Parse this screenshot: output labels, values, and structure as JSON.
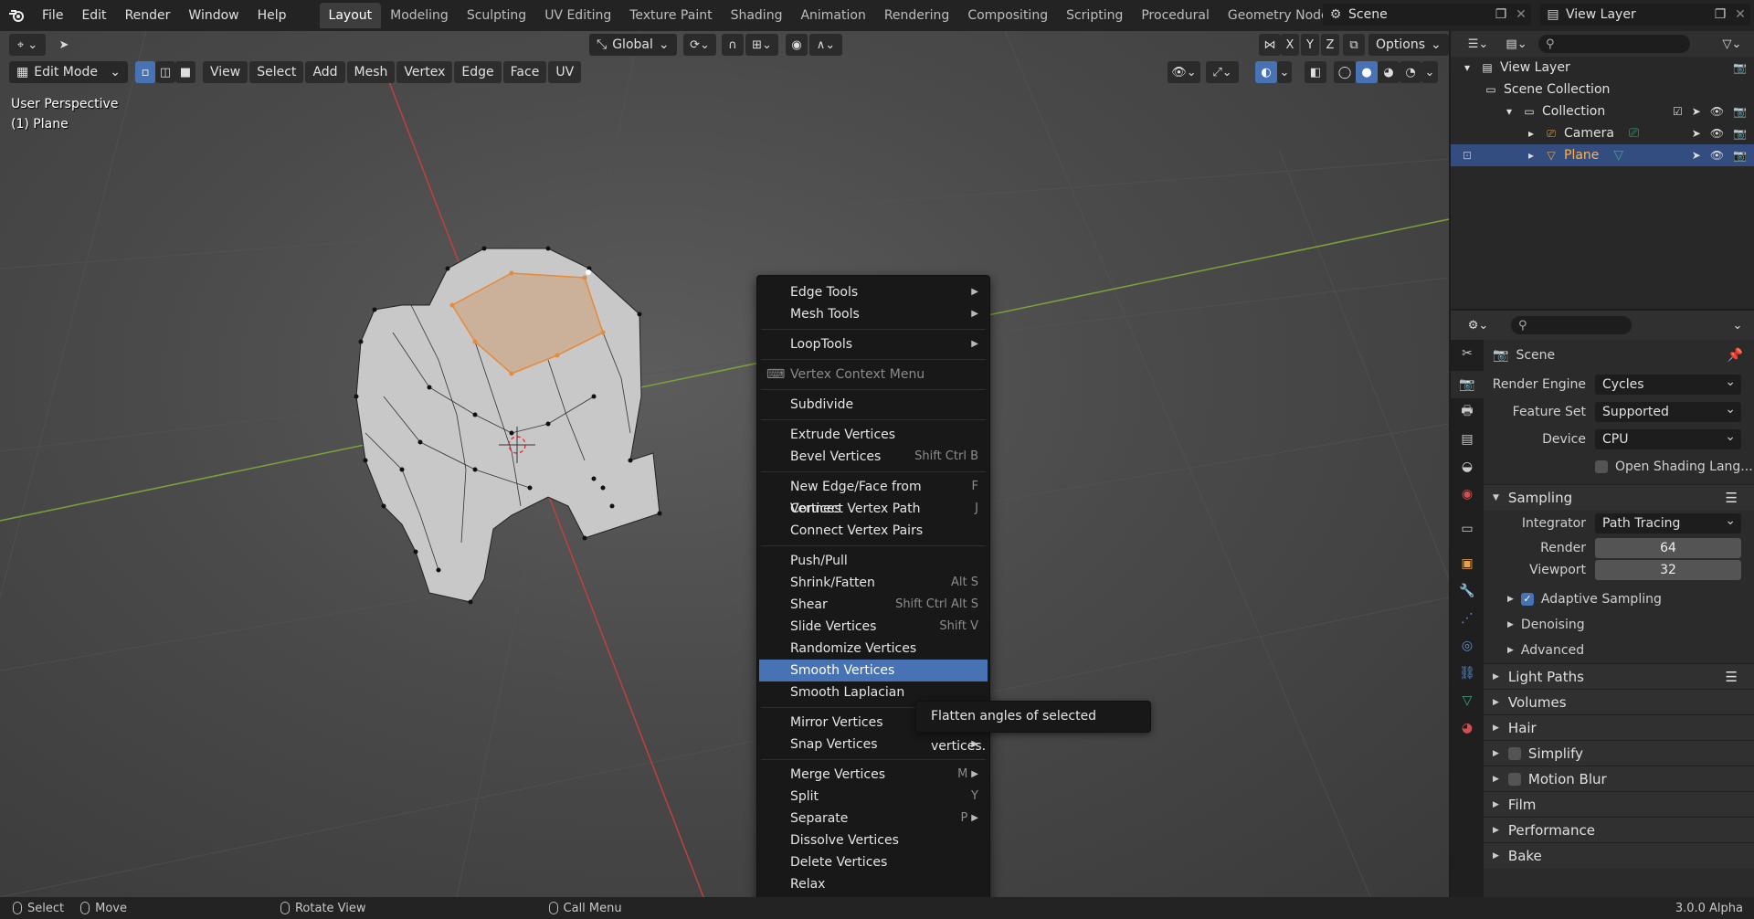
{
  "topbar": {
    "menus": [
      "File",
      "Edit",
      "Render",
      "Window",
      "Help"
    ],
    "workspaces": [
      "Layout",
      "Modeling",
      "Sculpting",
      "UV Editing",
      "Texture Paint",
      "Shading",
      "Animation",
      "Rendering",
      "Compositing",
      "Scripting",
      "Procedural",
      "Geometry Nodes"
    ],
    "active_workspace": "Layout",
    "scene": "Scene",
    "view_layer": "View Layer"
  },
  "viewport": {
    "transform_orientation": "Global",
    "options_label": "Options",
    "axes": [
      "X",
      "Y",
      "Z"
    ],
    "mode": "Edit Mode",
    "menus": [
      "View",
      "Select",
      "Add",
      "Mesh",
      "Vertex",
      "Edge",
      "Face",
      "UV"
    ],
    "perspective": "User Perspective",
    "object": "(1) Plane"
  },
  "context_menu": {
    "items": [
      {
        "label": "Edge Tools",
        "shortcut": "",
        "submenu": true
      },
      {
        "label": "Mesh Tools",
        "shortcut": "",
        "submenu": true
      },
      {
        "sep": true
      },
      {
        "label": "LoopTools",
        "shortcut": "",
        "submenu": true
      },
      {
        "sep": true
      },
      {
        "label": "Vertex Context Menu",
        "title": true
      },
      {
        "sep": true
      },
      {
        "label": "Subdivide",
        "shortcut": ""
      },
      {
        "sep": true
      },
      {
        "label": "Extrude Vertices",
        "shortcut": ""
      },
      {
        "label": "Bevel Vertices",
        "shortcut": "Shift Ctrl B"
      },
      {
        "sep": true
      },
      {
        "label": "New Edge/Face from Vertices",
        "shortcut": "F"
      },
      {
        "label": "Connect Vertex Path",
        "shortcut": "J"
      },
      {
        "label": "Connect Vertex Pairs",
        "shortcut": ""
      },
      {
        "sep": true
      },
      {
        "label": "Push/Pull",
        "shortcut": ""
      },
      {
        "label": "Shrink/Fatten",
        "shortcut": "Alt S"
      },
      {
        "label": "Shear",
        "shortcut": "Shift Ctrl Alt S"
      },
      {
        "label": "Slide Vertices",
        "shortcut": "Shift V"
      },
      {
        "label": "Randomize Vertices",
        "shortcut": ""
      },
      {
        "label": "Smooth Vertices",
        "shortcut": "",
        "highlight": true
      },
      {
        "label": "Smooth Laplacian",
        "shortcut": ""
      },
      {
        "sep": true
      },
      {
        "label": "Mirror Vertices",
        "shortcut": ""
      },
      {
        "label": "Snap Vertices",
        "shortcut": "",
        "submenu": true
      },
      {
        "sep": true
      },
      {
        "label": "Merge Vertices",
        "shortcut": "M",
        "submenu": true
      },
      {
        "label": "Split",
        "shortcut": "Y"
      },
      {
        "label": "Separate",
        "shortcut": "P",
        "submenu": true
      },
      {
        "label": "Dissolve Vertices",
        "shortcut": ""
      },
      {
        "label": "Delete Vertices",
        "shortcut": ""
      },
      {
        "label": "Relax",
        "shortcut": ""
      }
    ]
  },
  "tooltip": "Flatten angles of selected vertices.",
  "outliner": {
    "view_layer": "View Layer",
    "scene_collection": "Scene Collection",
    "collection": "Collection",
    "camera": "Camera",
    "plane": "Plane"
  },
  "properties": {
    "context": "Scene",
    "render_engine_label": "Render Engine",
    "render_engine": "Cycles",
    "feature_set_label": "Feature Set",
    "feature_set": "Supported",
    "device_label": "Device",
    "device": "CPU",
    "osl_label": "Open Shading Lang...",
    "sampling": "Sampling",
    "integrator_label": "Integrator",
    "integrator": "Path Tracing",
    "render_label": "Render",
    "render_samples": "64",
    "viewport_label": "Viewport",
    "viewport_samples": "32",
    "adaptive_sampling": "Adaptive Sampling",
    "denoising": "Denoising",
    "advanced": "Advanced",
    "panels": [
      "Light Paths",
      "Volumes",
      "Hair",
      "Simplify",
      "Motion Blur",
      "Film",
      "Performance",
      "Bake"
    ]
  },
  "statusbar": {
    "select": "Select",
    "move": "Move",
    "rotate": "Rotate View",
    "call_menu": "Call Menu",
    "version": "3.0.0 Alpha"
  },
  "colors": {
    "accent": "#4772b3",
    "selected_text": "#ffb144",
    "edge_highlight": "#e68a3c"
  }
}
